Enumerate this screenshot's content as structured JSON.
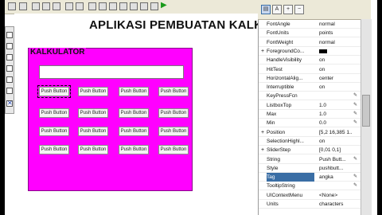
{
  "app_title": "APLIKASI PEMBUATAN KALK",
  "panel": {
    "title": "KALKULATOR",
    "color": "#ff00ff"
  },
  "buttons": {
    "rows": [
      [
        "Push Button",
        "Push Button",
        "Push Button",
        "Push Button"
      ],
      [
        "Push Button",
        "Push Button",
        "Push Button",
        "Push Button"
      ],
      [
        "Push Button",
        "Push Button",
        "Push Button",
        "Push Button"
      ],
      [
        "Push Button",
        "Push Button",
        "Push Button",
        "Push Button"
      ]
    ]
  },
  "toolbar_icons": [
    "save-icon",
    "open-icon",
    "cut-icon",
    "copy-icon",
    "paste-icon",
    "undo-icon",
    "redo-icon",
    "align-icon",
    "menu-editor-icon",
    "tab-order-icon",
    "toolbar-editor-icon",
    "mfile-icon",
    "inspector-icon",
    "object-browser-icon",
    "run-icon"
  ],
  "inspector": {
    "tabs": [
      "sort-category-icon",
      "sort-alpha-icon",
      "expand-icon",
      "collapse-icon"
    ],
    "rows": [
      {
        "name": "FontAngle",
        "value": "normal",
        "expand": "",
        "pen": ""
      },
      {
        "name": "FontUnits",
        "value": "points",
        "expand": "",
        "pen": ""
      },
      {
        "name": "FontWeight",
        "value": "normal",
        "expand": "",
        "pen": ""
      },
      {
        "name": "ForegroundCo...",
        "value": "",
        "expand": "+",
        "pen": "",
        "swatch": "#000000"
      },
      {
        "name": "HandleVisibility",
        "value": "on",
        "expand": "",
        "pen": ""
      },
      {
        "name": "HitTest",
        "value": "on",
        "expand": "",
        "pen": ""
      },
      {
        "name": "HorizontalAlig...",
        "value": "center",
        "expand": "",
        "pen": ""
      },
      {
        "name": "Interruptible",
        "value": "on",
        "expand": "",
        "pen": ""
      },
      {
        "name": "KeyPressFcn",
        "value": "",
        "expand": "",
        "pen": "✎"
      },
      {
        "name": "ListboxTop",
        "value": "1.0",
        "expand": "",
        "pen": "✎"
      },
      {
        "name": "Max",
        "value": "1.0",
        "expand": "",
        "pen": "✎"
      },
      {
        "name": "Min",
        "value": "0.0",
        "expand": "",
        "pen": "✎"
      },
      {
        "name": "Position",
        "value": "[5,2 16,385 1...",
        "expand": "+",
        "pen": ""
      },
      {
        "name": "SelectionHighl...",
        "value": "on",
        "expand": "",
        "pen": ""
      },
      {
        "name": "SliderStep",
        "value": "[0,01 0,1]",
        "expand": "+",
        "pen": ""
      },
      {
        "name": "String",
        "value": "Push Butt...",
        "expand": "",
        "pen": "✎"
      },
      {
        "name": "Style",
        "value": "pushbutt...",
        "expand": "",
        "pen": ""
      },
      {
        "name": "Tag",
        "value": "angka",
        "expand": "",
        "pen": "✎",
        "selected": true
      },
      {
        "name": "TooltipString",
        "value": "",
        "expand": "",
        "pen": "✎"
      },
      {
        "name": "UIContextMenu",
        "value": "<None>",
        "expand": "",
        "pen": ""
      },
      {
        "name": "Units",
        "value": "characters",
        "expand": "",
        "pen": ""
      }
    ]
  }
}
